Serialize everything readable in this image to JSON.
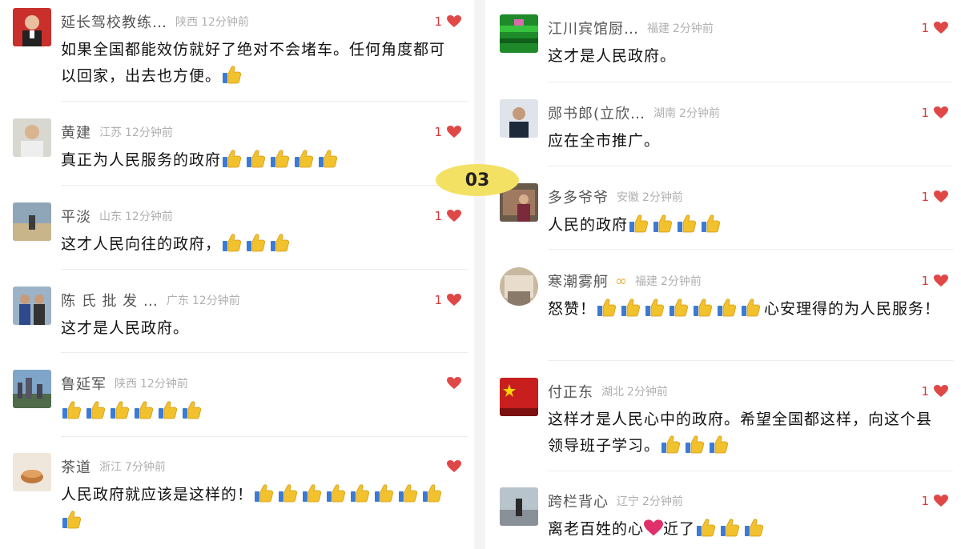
{
  "marker": "03",
  "colors": {
    "heart": "#e04848",
    "marker": "#f3e163",
    "thumb": "#f2c12e"
  },
  "left_comments": [
    {
      "name": "延长驾校教练…",
      "region": "陕西",
      "time": "12分钟前",
      "likes": "1",
      "pre": "如果全国都能效仿就好了绝对不会堵车。任何角度都可以回家，出去也方便。",
      "thumbs": 1,
      "mid": "",
      "thumbs2": 0
    },
    {
      "name": "黄建",
      "region": "江苏",
      "time": "12分钟前",
      "likes": "1",
      "pre": "真正为人民服务的政府",
      "thumbs": 5,
      "mid": "",
      "thumbs2": 0
    },
    {
      "name": "平淡",
      "region": "山东",
      "time": "12分钟前",
      "likes": "1",
      "pre": "这才人民向往的政府，",
      "thumbs": 3,
      "mid": "",
      "thumbs2": 0
    },
    {
      "name": "陈 氏 批 发 …",
      "region": "广东",
      "time": "12分钟前",
      "likes": "1",
      "pre": "这才是人民政府。",
      "thumbs": 0,
      "mid": "",
      "thumbs2": 0
    },
    {
      "name": "鲁延军",
      "region": "陕西",
      "time": "12分钟前",
      "likes": "",
      "pre": "",
      "thumbs": 6,
      "mid": "",
      "thumbs2": 0
    },
    {
      "name": "茶道",
      "region": "浙江",
      "time": "7分钟前",
      "likes": "",
      "pre": "人民政府就应该是这样的！",
      "thumbs": 9,
      "mid": "",
      "thumbs2": 0
    }
  ],
  "right_comments": [
    {
      "name": "江川宾馆厨…",
      "region": "福建",
      "time": "2分钟前",
      "likes": "1",
      "pre": "这才是人民政府。",
      "thumbs": 0,
      "mid": "",
      "thumbs2": 0
    },
    {
      "name": "郧书郎(立欣…",
      "region": "湖南",
      "time": "2分钟前",
      "likes": "1",
      "pre": "应在全市推广。",
      "thumbs": 0,
      "mid": "",
      "thumbs2": 0
    },
    {
      "name": "多多爷爷",
      "region": "安徽",
      "time": "2分钟前",
      "likes": "1",
      "pre": "人民的政府",
      "thumbs": 4,
      "mid": "",
      "thumbs2": 0
    },
    {
      "name": "寒潮雾舸",
      "region": "福建",
      "time": "2分钟前",
      "likes": "1",
      "badge": "∞",
      "pre": "怒赞！",
      "thumbs": 7,
      "mid": "心安理得的为人民服务！",
      "thumbs2": 0
    },
    {
      "name": "付正东",
      "region": "湖北",
      "time": "2分钟前",
      "likes": "1",
      "pre": "这样才是人民心中的政府。希望全国都这样，向这个县领导班子学习。",
      "thumbs": 3,
      "mid": "",
      "thumbs2": 0
    },
    {
      "name": "跨栏背心",
      "region": "辽宁",
      "time": "2分钟前",
      "likes": "1",
      "pre": "离老百姓的心",
      "heart_inline": true,
      "post_heart": "近了",
      "thumbs": 3,
      "mid": "",
      "thumbs2": 0
    }
  ]
}
